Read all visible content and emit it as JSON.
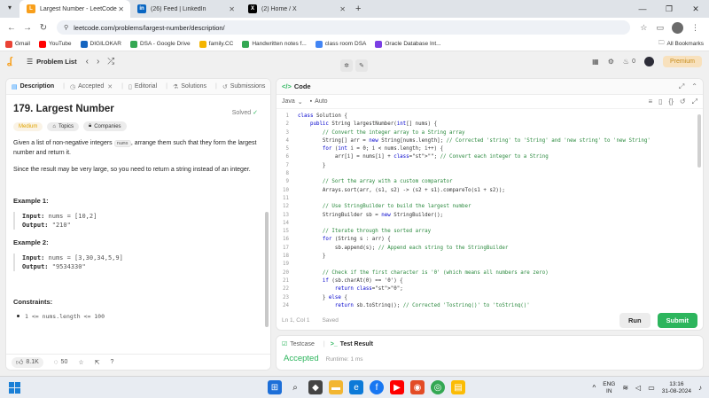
{
  "browser": {
    "tabs": [
      {
        "title": "Largest Number - LeetCode",
        "icon": "leetcode-icon",
        "color": "#f89f1b",
        "active": true
      },
      {
        "title": "(26) Feed | LinkedIn",
        "icon": "linkedin-icon",
        "color": "#0a66c2",
        "active": false
      },
      {
        "title": "(2) Home / X",
        "icon": "x-icon",
        "color": "#000000",
        "active": false
      }
    ],
    "url": "leetcode.com/problems/largest-number/description/",
    "bookmarks": [
      {
        "label": "Gmail",
        "color": "#ea4335"
      },
      {
        "label": "YouTube",
        "color": "#ff0000"
      },
      {
        "label": "DIGILOKAR",
        "color": "#1565c0"
      },
      {
        "label": "DSA - Google Drive",
        "color": "#34a853"
      },
      {
        "label": "family.CC",
        "color": "#f4b400"
      },
      {
        "label": "Handwritten notes f...",
        "color": "#34a853"
      },
      {
        "label": "class room DSA",
        "color": "#4285f4"
      },
      {
        "label": "Oracle Database Int...",
        "color": "#7b3fe4"
      }
    ],
    "all_bookmarks": "All Bookmarks"
  },
  "lcnav": {
    "problem_list": "Problem List",
    "streak": "0",
    "premium": "Premium"
  },
  "left": {
    "tabs": [
      "Description",
      "Accepted",
      "Editorial",
      "Solutions",
      "Submissions"
    ],
    "title": "179. Largest Number",
    "solved": "Solved",
    "tags": [
      "Medium",
      "Topics",
      "Companies"
    ],
    "para1_a": "Given a list of non-negative integers ",
    "para1_code": "nums",
    "para1_b": ", arrange them such that they form the largest number and return it.",
    "para2": "Since the result may be very large, so you need to return a string instead of an integer.",
    "example1": {
      "heading": "Example 1:",
      "input_label": "Input:",
      "input": "nums = [10,2]",
      "output_label": "Output:",
      "output": "\"210\""
    },
    "example2": {
      "heading": "Example 2:",
      "input_label": "Input:",
      "input": "nums = [3,30,34,5,9]",
      "output_label": "Output:",
      "output": "\"9534330\""
    },
    "constraints_heading": "Constraints:",
    "constraint1": "1 <= nums.length <= 100",
    "likes": "8.1K",
    "comments": "50"
  },
  "code": {
    "heading": "Code",
    "language": "Java",
    "mode": "Auto",
    "lines": [
      {
        "n": "1",
        "t": "class Solution {"
      },
      {
        "n": "2",
        "t": "    public String largestNumber(int[] nums) {"
      },
      {
        "n": "3",
        "t": "        // Convert the integer array to a String array"
      },
      {
        "n": "4",
        "t": "        String[] arr = new String[nums.length]; // Corrected 'string' to 'String' and 'new string' to 'new String'"
      },
      {
        "n": "5",
        "t": "        for (int i = 0; i < nums.length; i++) {"
      },
      {
        "n": "6",
        "t": "            arr[i] = nums[i] + \"\"; // Convert each integer to a String"
      },
      {
        "n": "7",
        "t": "        }"
      },
      {
        "n": "8",
        "t": ""
      },
      {
        "n": "9",
        "t": "        // Sort the array with a custom comparator"
      },
      {
        "n": "10",
        "t": "        Arrays.sort(arr, (s1, s2) -> (s2 + s1).compareTo(s1 + s2));"
      },
      {
        "n": "11",
        "t": ""
      },
      {
        "n": "12",
        "t": "        // Use StringBuilder to build the largest number"
      },
      {
        "n": "13",
        "t": "        StringBuilder sb = new StringBuilder();"
      },
      {
        "n": "14",
        "t": ""
      },
      {
        "n": "15",
        "t": "        // Iterate through the sorted array"
      },
      {
        "n": "16",
        "t": "        for (String s : arr) {"
      },
      {
        "n": "17",
        "t": "            sb.append(s); // Append each string to the StringBuilder"
      },
      {
        "n": "18",
        "t": "        }"
      },
      {
        "n": "19",
        "t": ""
      },
      {
        "n": "20",
        "t": "        // Check if the first character is '0' (which means all numbers are zero)"
      },
      {
        "n": "21",
        "t": "        if (sb.charAt(0) == '0') {"
      },
      {
        "n": "22",
        "t": "            return \"0\";"
      },
      {
        "n": "23",
        "t": "        } else {"
      },
      {
        "n": "24",
        "t": "            return sb.toString(); // Corrected 'Tostring()' to 'toString()'"
      }
    ],
    "cursor": "Ln 1, Col 1",
    "saved": "Saved",
    "run": "Run",
    "submit": "Submit"
  },
  "test": {
    "tab1": "Testcase",
    "tab2": "Test Result",
    "status": "Accepted",
    "runtime": "Runtime: 1 ms"
  },
  "taskbar": {
    "lang1": "ENG",
    "lang2": "IN",
    "time": "13:16",
    "date": "31-08-2024"
  }
}
